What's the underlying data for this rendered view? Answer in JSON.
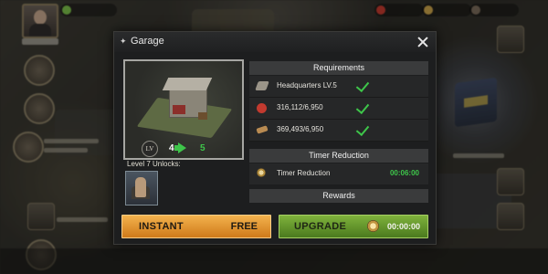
{
  "dialog": {
    "title": "Garage",
    "close_icon": "close-icon",
    "preview": {
      "level_from": "4",
      "level_to": "5",
      "unlocks_label": "Level 7 Unlocks:"
    },
    "requirements_header": "Requirements",
    "requirements": [
      {
        "icon": "headquarters-icon",
        "text": "Headquarters LV.5",
        "met": true
      },
      {
        "icon": "food-icon",
        "text": "316,112/6,950",
        "met": true
      },
      {
        "icon": "wood-icon",
        "text": "369,493/6,950",
        "met": true
      }
    ],
    "timer_header": "Timer Reduction",
    "timer": {
      "label": "Timer Reduction",
      "value": "00:06:00"
    },
    "rewards_header": "Rewards",
    "buttons": {
      "instant_label": "INSTANT",
      "instant_cost": "FREE",
      "upgrade_label": "UPGRADE",
      "upgrade_time": "00:00:00"
    }
  },
  "colors": {
    "accent_green": "#3ec54a",
    "instant_orange": "#e89a36",
    "upgrade_green": "#6a9b2f"
  }
}
